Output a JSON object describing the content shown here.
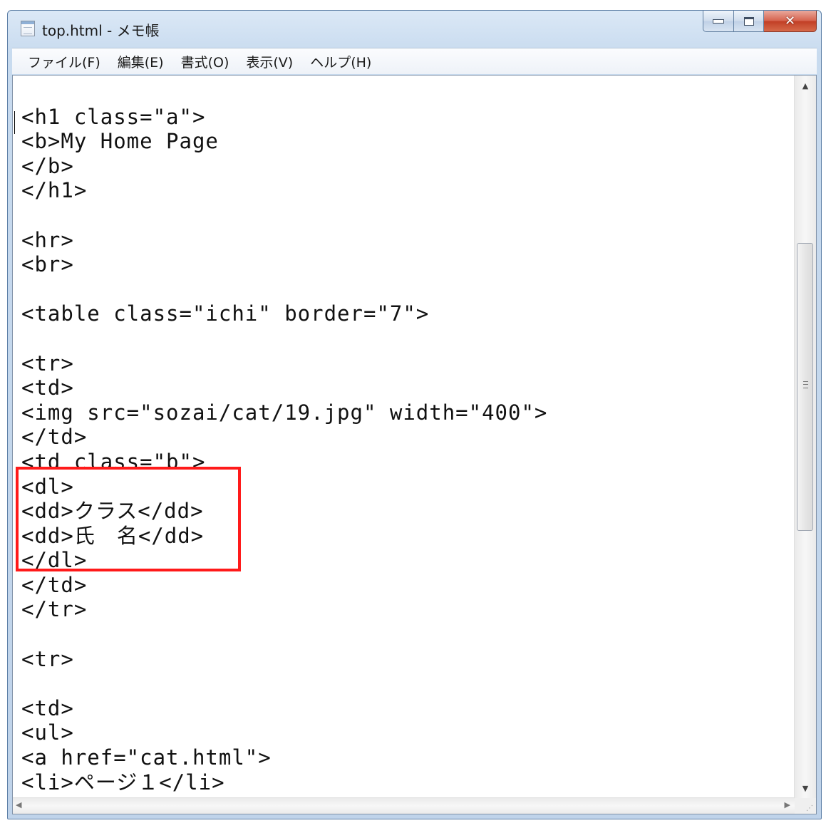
{
  "window": {
    "title": "top.html - メモ帳"
  },
  "menu": [
    "ファイル(F)",
    "編集(E)",
    "書式(O)",
    "表示(V)",
    "ヘルプ(H)"
  ],
  "editor_lines": [
    "",
    "<h1 class=\"a\">",
    "<b>My Home Page",
    "</b>",
    "</h1>",
    "",
    "<hr>",
    "<br>",
    "",
    "<table class=\"ichi\" border=\"7\">",
    "",
    "<tr>",
    "<td>",
    "<img src=\"sozai/cat/19.jpg\" width=\"400\">",
    "</td>",
    "<td class=\"b\">",
    "<dl>",
    "<dd>クラス</dd>",
    "<dd>氏　名</dd>",
    "</dl>",
    "</td>",
    "</tr>",
    "",
    "<tr>",
    "",
    "<td>",
    "<ul>",
    "<a href=\"cat.html\">",
    "<li>ページ１</li>"
  ],
  "colors": {
    "highlight": "#ff1a1a",
    "close_button": "#c13e25",
    "titlebar": "#dbe8f6"
  },
  "icons": [
    "notepad-icon",
    "minimize-icon",
    "maximize-icon",
    "close-icon"
  ]
}
